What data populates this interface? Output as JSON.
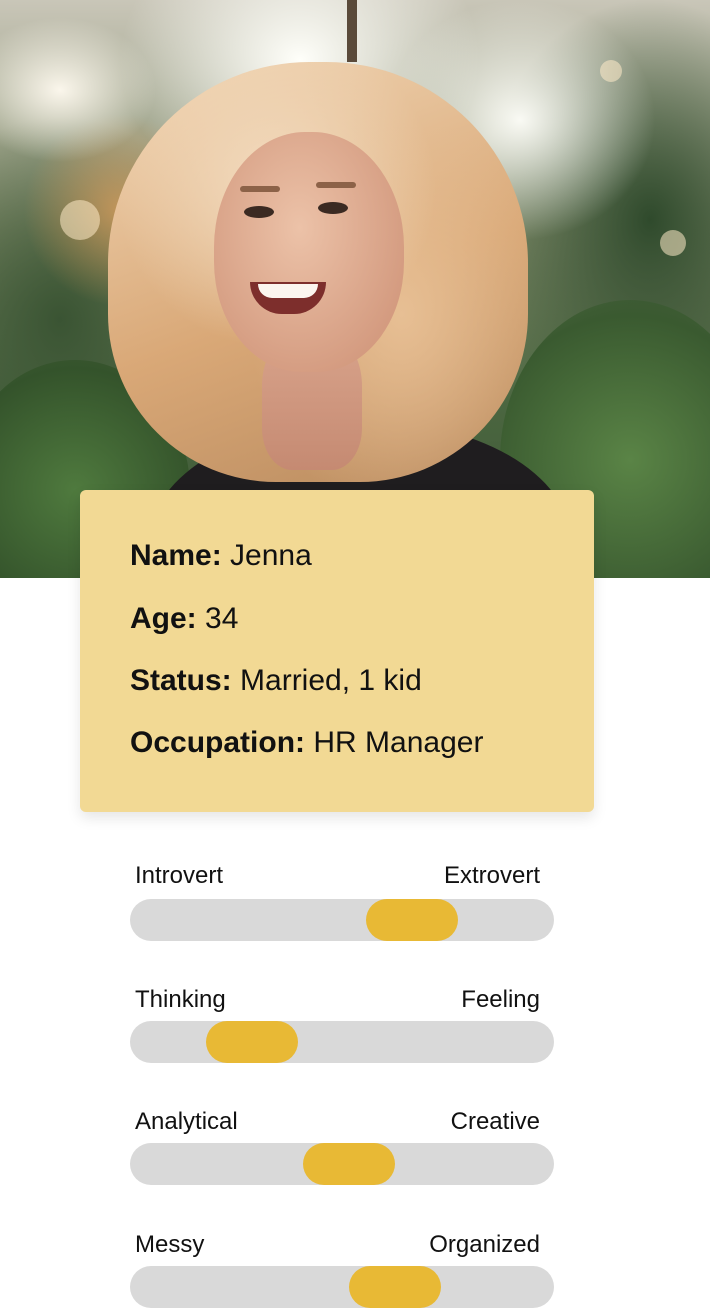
{
  "profile": {
    "name_label": "Name:",
    "name": "Jenna",
    "age_label": "Age:",
    "age": "34",
    "status_label": "Status:",
    "status": "Married, 1 kid",
    "occupation_label": "Occupation:",
    "occupation": "HR Manager"
  },
  "traits": [
    {
      "left_label": "Introvert",
      "right_label": "Extrovert",
      "value": 0.71
    },
    {
      "left_label": "Thinking",
      "right_label": "Feeling",
      "value": 0.23
    },
    {
      "left_label": "Analytical",
      "right_label": "Creative",
      "value": 0.52
    },
    {
      "left_label": "Messy",
      "right_label": "Organized",
      "value": 0.66
    }
  ],
  "colors": {
    "card_background": "#f2d994",
    "slider_track": "#d9d9d9",
    "slider_thumb": "#e8b935"
  }
}
